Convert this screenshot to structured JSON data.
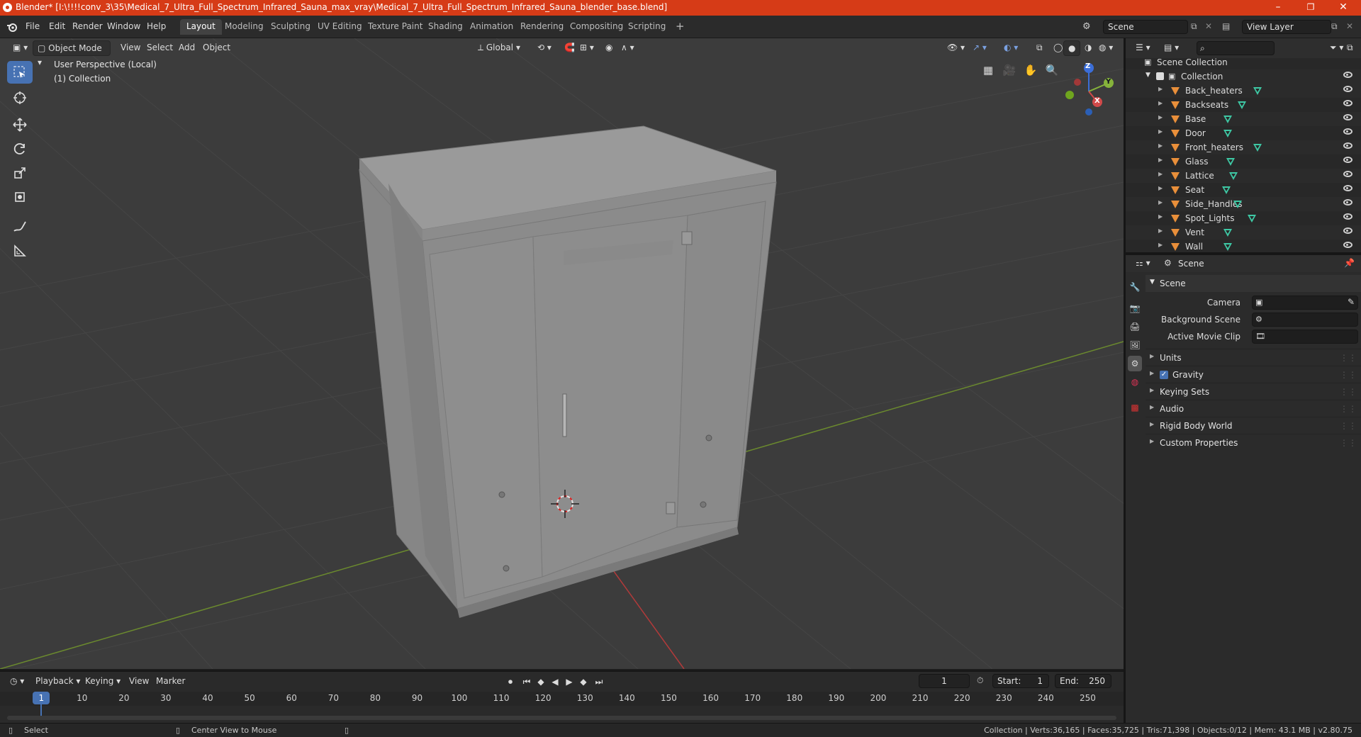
{
  "titlebar": {
    "title": "Blender* [I:\\!!!!conv_3\\35\\Medical_7_Ultra_Full_Spectrum_Infrared_Sauna_max_vray\\Medical_7_Ultra_Full_Spectrum_Infrared_Sauna_blender_base.blend]",
    "minimize": "–",
    "restore": "❐",
    "close": "✕"
  },
  "menubar": {
    "items": [
      "File",
      "Edit",
      "Render",
      "Window",
      "Help"
    ]
  },
  "workspaces": [
    "Layout",
    "Modeling",
    "Sculpting",
    "UV Editing",
    "Texture Paint",
    "Shading",
    "Animation",
    "Rendering",
    "Compositing",
    "Scripting"
  ],
  "scene_selector": {
    "value": "Scene"
  },
  "viewlayer_selector": {
    "value": "View Layer"
  },
  "viewport_header": {
    "mode": "Object Mode",
    "menus": [
      "View",
      "Select",
      "Add",
      "Object"
    ],
    "orientation": "Global"
  },
  "viewport_overlay": {
    "perspective": "User Perspective (Local)",
    "collection": "(1) Collection"
  },
  "gizmo": {
    "z": "Z",
    "y": "Y",
    "x": "X"
  },
  "outliner": {
    "search_placeholder": "",
    "root": "Scene Collection",
    "collection": "Collection",
    "objects": [
      "Back_heaters",
      "Backseats",
      "Base",
      "Door",
      "Front_heaters",
      "Glass",
      "Lattice",
      "Seat",
      "Side_Handles",
      "Spot_Lights",
      "Vent",
      "Wall"
    ]
  },
  "properties": {
    "header": "Scene",
    "panel_title": "Scene",
    "camera_label": "Camera",
    "background_label": "Background Scene",
    "movieclip_label": "Active Movie Clip",
    "sections": [
      "Units",
      "Gravity",
      "Keying Sets",
      "Audio",
      "Rigid Body World",
      "Custom Properties"
    ]
  },
  "timeline": {
    "menus": [
      "Playback",
      "Keying",
      "View",
      "Marker"
    ],
    "current_frame": "1",
    "start_label": "Start:",
    "start_value": "1",
    "end_label": "End:",
    "end_value": "250",
    "ruler": [
      "1",
      "10",
      "20",
      "30",
      "40",
      "50",
      "60",
      "70",
      "80",
      "90",
      "100",
      "110",
      "120",
      "130",
      "140",
      "150",
      "160",
      "170",
      "180",
      "190",
      "200",
      "210",
      "220",
      "230",
      "240",
      "250"
    ]
  },
  "statusbar": {
    "select": "Select",
    "center_view": "Center View to Mouse",
    "stats": "Collection | Verts:36,165 | Faces:35,725 | Tris:71,398 | Objects:0/12 | Mem: 43.1 MB | v2.80.75"
  },
  "colors": {
    "titlebar": "#d63b17",
    "accent": "#4772b3",
    "object_icon": "#e98f3a",
    "mesh_icon": "#3ec8a4"
  }
}
